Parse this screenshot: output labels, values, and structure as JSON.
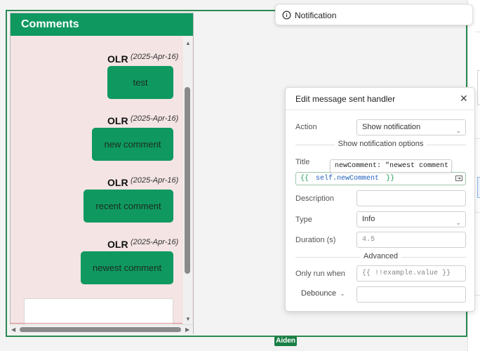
{
  "toast": {
    "title": "Notification"
  },
  "comments": {
    "header": "Comments",
    "messages": [
      {
        "author": "OLR",
        "date": "(2025-Apr-16)",
        "text": "test"
      },
      {
        "author": "OLR",
        "date": "(2025-Apr-16)",
        "text": "new comment"
      },
      {
        "author": "OLR",
        "date": "(2025-Apr-16)",
        "text": "recent comment"
      },
      {
        "author": "OLR",
        "date": "(2025-Apr-16)",
        "text": "newest comment"
      }
    ]
  },
  "selection": {
    "tag": "Aiden"
  },
  "panel": {
    "title": "Edit message sent handler",
    "action": {
      "label": "Action",
      "value": "Show notification"
    },
    "options_section": "Show notification options",
    "title_field": {
      "label": "Title",
      "open": "{{",
      "expr_prefix": "self.",
      "expr": "newComment",
      "close": "}}"
    },
    "tooltip": "newComment: \"newest comment \"",
    "description": {
      "label": "Description",
      "value": ""
    },
    "type": {
      "label": "Type",
      "value": "Info"
    },
    "duration": {
      "label": "Duration (s)",
      "placeholder": "4.5"
    },
    "advanced_section": "Advanced",
    "only_run_when": {
      "label": "Only run when",
      "placeholder": "{{ !!example.value }}"
    },
    "debounce": {
      "label": "Debounce",
      "value": ""
    }
  },
  "colors": {
    "brand_green": "#0f9960",
    "selection_green": "#2a8a52",
    "comments_bg": "#f4e4e4"
  },
  "icons": [
    "info-circle-icon",
    "close-icon",
    "chevron-down-icon",
    "expand-icon",
    "scroll-up-arrow-icon",
    "scroll-down-arrow-icon",
    "scroll-left-arrow-icon",
    "scroll-right-arrow-icon"
  ]
}
